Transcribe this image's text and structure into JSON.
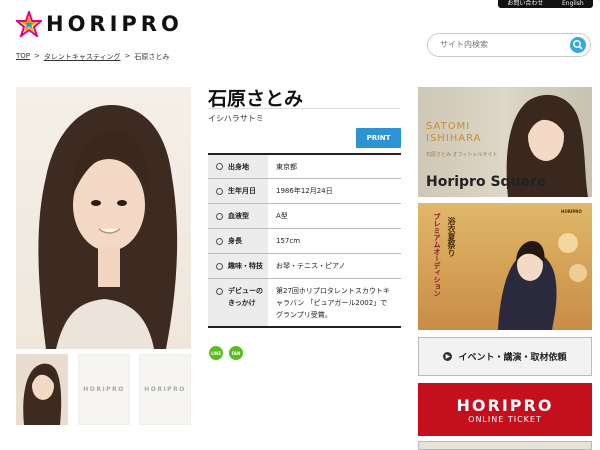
{
  "header": {
    "top_links": [
      "お問い合わせ",
      "English"
    ],
    "logo": "HORIPRO",
    "search_placeholder": "サイト内検索"
  },
  "breadcrumb": [
    "TOP",
    ">",
    "タレントキャスティング",
    ">",
    "石原さとみ"
  ],
  "profile": {
    "name": "石原さとみ",
    "kana": "イシハラサトミ",
    "print_label": "PRINT",
    "rows": [
      {
        "label": "出身地",
        "value": "東京都"
      },
      {
        "label": "生年月日",
        "value": "1986年12月24日"
      },
      {
        "label": "血液型",
        "value": "A型"
      },
      {
        "label": "身長",
        "value": "157cm"
      },
      {
        "label": "趣味・特技",
        "value": "お琴・テニス・ピアノ"
      },
      {
        "label": "デビューのきっかけ",
        "value": "第27回ホリプロタレントスカウトキャラバン 「ピュアガール2002」でグランプリ受賞。"
      }
    ],
    "thumb_logo": "HORIPRO",
    "sns": [
      "LINE",
      "FAN"
    ]
  },
  "sidebar": {
    "square_banner": {
      "name": "SATOMI ISHIHARA",
      "caption": "石原さとみ オフィシャルサイト",
      "brand": "Horipro Square"
    },
    "audition_banner": {
      "title": "浴衣夏祭り",
      "subtitle": "プレミアムオーディション",
      "brand": "HORIPRO"
    },
    "event_button": "イベント・講演・取材依頼",
    "ticket_banner": {
      "line1": "HORIPRO",
      "line2": "ONLINE TICKET"
    }
  }
}
